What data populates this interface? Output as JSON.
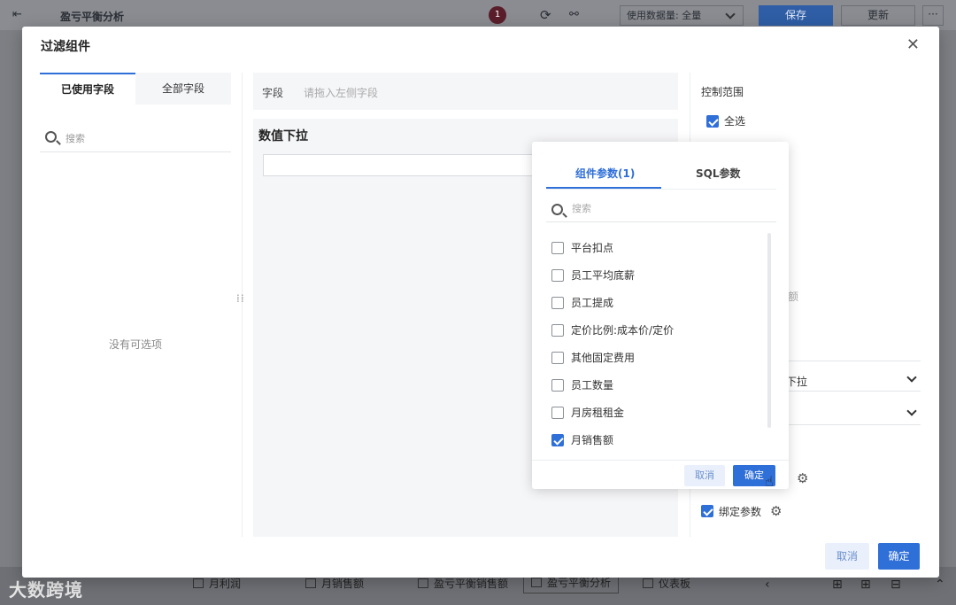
{
  "topbar": {
    "title": "盈亏平衡分析",
    "avatar": "1",
    "data_select": "使用数据量: 全量",
    "save": "保存",
    "update": "更新",
    "more": "···"
  },
  "modal": {
    "title": "过滤组件",
    "close": "✕"
  },
  "left": {
    "tabs": [
      "已使用字段",
      "全部字段"
    ],
    "search_placeholder": "搜索",
    "empty": "没有可选项"
  },
  "middle": {
    "field_label": "字段",
    "field_placeholder": "请拖入左侧字段",
    "component_title": "数值下拉"
  },
  "right": {
    "control_range": "控制范围",
    "select_all": "全选",
    "select_all_checked": true,
    "faded_text": "额",
    "select1": "下拉",
    "select2": "",
    "bind_param": "绑定参数",
    "bind_param_checked": true
  },
  "footer": {
    "cancel": "取消",
    "ok": "确定"
  },
  "popover": {
    "tabs": [
      "组件参数(1)",
      "SQL参数"
    ],
    "search_placeholder": "搜索",
    "items": [
      {
        "label": "平台扣点",
        "checked": false
      },
      {
        "label": "员工平均底薪",
        "checked": false
      },
      {
        "label": "员工提成",
        "checked": false
      },
      {
        "label": "定价比例:成本价/定价",
        "checked": false
      },
      {
        "label": "其他固定费用",
        "checked": false
      },
      {
        "label": "员工数量",
        "checked": false
      },
      {
        "label": "月房租租金",
        "checked": false
      },
      {
        "label": "月销售额",
        "checked": true
      }
    ],
    "cancel": "取消",
    "ok": "确定"
  },
  "bottombar": {
    "brand": "大数跨境",
    "tabs": [
      "月利润",
      "月销售额",
      "盈亏平衡销售额",
      "盈亏平衡分析",
      "仪表板"
    ]
  },
  "colors": {
    "accent": "#2f6fd8",
    "save_button": "#2f5ea6"
  }
}
